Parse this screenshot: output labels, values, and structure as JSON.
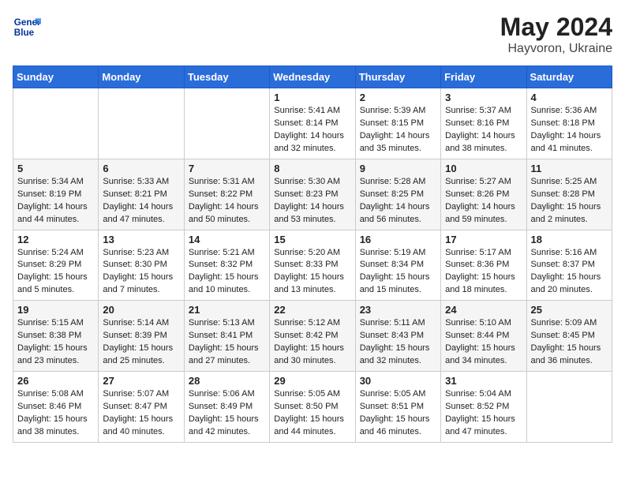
{
  "header": {
    "logo_line1": "General",
    "logo_line2": "Blue",
    "month_year": "May 2024",
    "location": "Hayvoron, Ukraine"
  },
  "columns": [
    "Sunday",
    "Monday",
    "Tuesday",
    "Wednesday",
    "Thursday",
    "Friday",
    "Saturday"
  ],
  "weeks": [
    [
      {
        "day": "",
        "sunrise": "",
        "sunset": "",
        "daylight": ""
      },
      {
        "day": "",
        "sunrise": "",
        "sunset": "",
        "daylight": ""
      },
      {
        "day": "",
        "sunrise": "",
        "sunset": "",
        "daylight": ""
      },
      {
        "day": "1",
        "sunrise": "Sunrise: 5:41 AM",
        "sunset": "Sunset: 8:14 PM",
        "daylight": "Daylight: 14 hours and 32 minutes."
      },
      {
        "day": "2",
        "sunrise": "Sunrise: 5:39 AM",
        "sunset": "Sunset: 8:15 PM",
        "daylight": "Daylight: 14 hours and 35 minutes."
      },
      {
        "day": "3",
        "sunrise": "Sunrise: 5:37 AM",
        "sunset": "Sunset: 8:16 PM",
        "daylight": "Daylight: 14 hours and 38 minutes."
      },
      {
        "day": "4",
        "sunrise": "Sunrise: 5:36 AM",
        "sunset": "Sunset: 8:18 PM",
        "daylight": "Daylight: 14 hours and 41 minutes."
      }
    ],
    [
      {
        "day": "5",
        "sunrise": "Sunrise: 5:34 AM",
        "sunset": "Sunset: 8:19 PM",
        "daylight": "Daylight: 14 hours and 44 minutes."
      },
      {
        "day": "6",
        "sunrise": "Sunrise: 5:33 AM",
        "sunset": "Sunset: 8:21 PM",
        "daylight": "Daylight: 14 hours and 47 minutes."
      },
      {
        "day": "7",
        "sunrise": "Sunrise: 5:31 AM",
        "sunset": "Sunset: 8:22 PM",
        "daylight": "Daylight: 14 hours and 50 minutes."
      },
      {
        "day": "8",
        "sunrise": "Sunrise: 5:30 AM",
        "sunset": "Sunset: 8:23 PM",
        "daylight": "Daylight: 14 hours and 53 minutes."
      },
      {
        "day": "9",
        "sunrise": "Sunrise: 5:28 AM",
        "sunset": "Sunset: 8:25 PM",
        "daylight": "Daylight: 14 hours and 56 minutes."
      },
      {
        "day": "10",
        "sunrise": "Sunrise: 5:27 AM",
        "sunset": "Sunset: 8:26 PM",
        "daylight": "Daylight: 14 hours and 59 minutes."
      },
      {
        "day": "11",
        "sunrise": "Sunrise: 5:25 AM",
        "sunset": "Sunset: 8:28 PM",
        "daylight": "Daylight: 15 hours and 2 minutes."
      }
    ],
    [
      {
        "day": "12",
        "sunrise": "Sunrise: 5:24 AM",
        "sunset": "Sunset: 8:29 PM",
        "daylight": "Daylight: 15 hours and 5 minutes."
      },
      {
        "day": "13",
        "sunrise": "Sunrise: 5:23 AM",
        "sunset": "Sunset: 8:30 PM",
        "daylight": "Daylight: 15 hours and 7 minutes."
      },
      {
        "day": "14",
        "sunrise": "Sunrise: 5:21 AM",
        "sunset": "Sunset: 8:32 PM",
        "daylight": "Daylight: 15 hours and 10 minutes."
      },
      {
        "day": "15",
        "sunrise": "Sunrise: 5:20 AM",
        "sunset": "Sunset: 8:33 PM",
        "daylight": "Daylight: 15 hours and 13 minutes."
      },
      {
        "day": "16",
        "sunrise": "Sunrise: 5:19 AM",
        "sunset": "Sunset: 8:34 PM",
        "daylight": "Daylight: 15 hours and 15 minutes."
      },
      {
        "day": "17",
        "sunrise": "Sunrise: 5:17 AM",
        "sunset": "Sunset: 8:36 PM",
        "daylight": "Daylight: 15 hours and 18 minutes."
      },
      {
        "day": "18",
        "sunrise": "Sunrise: 5:16 AM",
        "sunset": "Sunset: 8:37 PM",
        "daylight": "Daylight: 15 hours and 20 minutes."
      }
    ],
    [
      {
        "day": "19",
        "sunrise": "Sunrise: 5:15 AM",
        "sunset": "Sunset: 8:38 PM",
        "daylight": "Daylight: 15 hours and 23 minutes."
      },
      {
        "day": "20",
        "sunrise": "Sunrise: 5:14 AM",
        "sunset": "Sunset: 8:39 PM",
        "daylight": "Daylight: 15 hours and 25 minutes."
      },
      {
        "day": "21",
        "sunrise": "Sunrise: 5:13 AM",
        "sunset": "Sunset: 8:41 PM",
        "daylight": "Daylight: 15 hours and 27 minutes."
      },
      {
        "day": "22",
        "sunrise": "Sunrise: 5:12 AM",
        "sunset": "Sunset: 8:42 PM",
        "daylight": "Daylight: 15 hours and 30 minutes."
      },
      {
        "day": "23",
        "sunrise": "Sunrise: 5:11 AM",
        "sunset": "Sunset: 8:43 PM",
        "daylight": "Daylight: 15 hours and 32 minutes."
      },
      {
        "day": "24",
        "sunrise": "Sunrise: 5:10 AM",
        "sunset": "Sunset: 8:44 PM",
        "daylight": "Daylight: 15 hours and 34 minutes."
      },
      {
        "day": "25",
        "sunrise": "Sunrise: 5:09 AM",
        "sunset": "Sunset: 8:45 PM",
        "daylight": "Daylight: 15 hours and 36 minutes."
      }
    ],
    [
      {
        "day": "26",
        "sunrise": "Sunrise: 5:08 AM",
        "sunset": "Sunset: 8:46 PM",
        "daylight": "Daylight: 15 hours and 38 minutes."
      },
      {
        "day": "27",
        "sunrise": "Sunrise: 5:07 AM",
        "sunset": "Sunset: 8:47 PM",
        "daylight": "Daylight: 15 hours and 40 minutes."
      },
      {
        "day": "28",
        "sunrise": "Sunrise: 5:06 AM",
        "sunset": "Sunset: 8:49 PM",
        "daylight": "Daylight: 15 hours and 42 minutes."
      },
      {
        "day": "29",
        "sunrise": "Sunrise: 5:05 AM",
        "sunset": "Sunset: 8:50 PM",
        "daylight": "Daylight: 15 hours and 44 minutes."
      },
      {
        "day": "30",
        "sunrise": "Sunrise: 5:05 AM",
        "sunset": "Sunset: 8:51 PM",
        "daylight": "Daylight: 15 hours and 46 minutes."
      },
      {
        "day": "31",
        "sunrise": "Sunrise: 5:04 AM",
        "sunset": "Sunset: 8:52 PM",
        "daylight": "Daylight: 15 hours and 47 minutes."
      },
      {
        "day": "",
        "sunrise": "",
        "sunset": "",
        "daylight": ""
      }
    ]
  ]
}
